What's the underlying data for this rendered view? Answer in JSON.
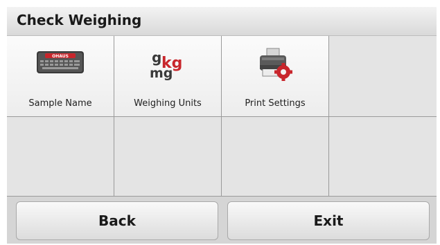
{
  "header": {
    "title": "Check Weighing"
  },
  "menu": {
    "items": [
      {
        "label": "Sample Name",
        "icon": "keyboard-icon"
      },
      {
        "label": "Weighing Units",
        "icon": "weighing-units-icon",
        "icon_text": {
          "g": "g",
          "kg": "kg",
          "mg": "mg"
        }
      },
      {
        "label": "Print Settings",
        "icon": "printer-settings-icon"
      }
    ],
    "keyboard_brand": "OHAUS"
  },
  "footer": {
    "back_label": "Back",
    "exit_label": "Exit"
  },
  "colors": {
    "accent_red": "#c8262c",
    "title_gradient_top": "#f3f3f3",
    "title_gradient_bottom": "#d9d9d9"
  }
}
